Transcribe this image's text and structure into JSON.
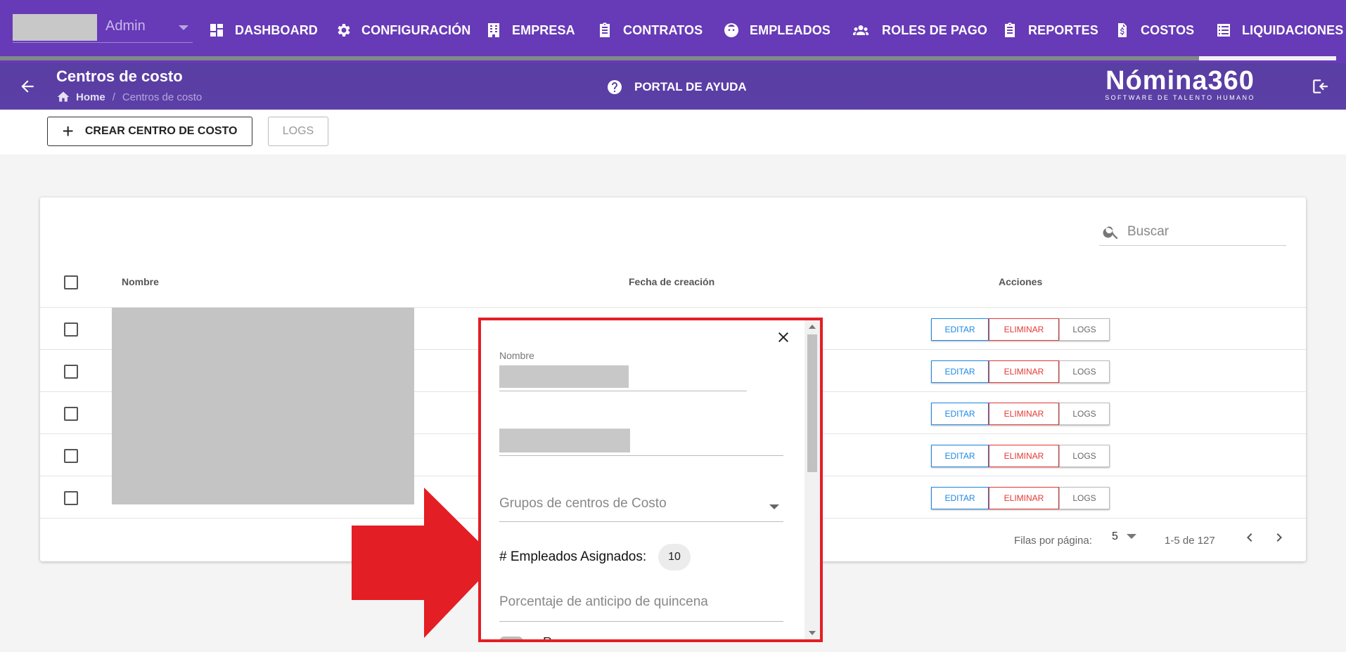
{
  "header": {
    "user_role": "Admin",
    "nav": [
      {
        "label": "DASHBOARD",
        "icon": "dashboard-icon"
      },
      {
        "label": "CONFIGURACIÓN",
        "icon": "gear-icon"
      },
      {
        "label": "EMPRESA",
        "icon": "building-icon"
      },
      {
        "label": "CONTRATOS",
        "icon": "clipboard-icon"
      },
      {
        "label": "EMPLEADOS",
        "icon": "face-icon"
      },
      {
        "label": "ROLES DE PAGO",
        "icon": "people-icon"
      },
      {
        "label": "REPORTES",
        "icon": "clipboard-icon"
      },
      {
        "label": "COSTOS",
        "icon": "dollar-file-icon"
      },
      {
        "label": "LIQUIDACIONES",
        "icon": "list-icon"
      }
    ]
  },
  "subheader": {
    "title": "Centros de costo",
    "breadcrumb_home": "Home",
    "breadcrumb_sep": "/",
    "breadcrumb_current": "Centros de costo",
    "help_label": "PORTAL DE AYUDA",
    "logo_main": "Nómina360",
    "logo_sub": "SOFTWARE DE TALENTO HUMANO"
  },
  "toolbar": {
    "create_label": "CREAR CENTRO DE COSTO",
    "create_icon": "+",
    "logs_label": "LOGS"
  },
  "table": {
    "search_placeholder": "Buscar",
    "columns": [
      "Nombre",
      "Fecha de creación",
      "Acciones"
    ],
    "row_actions": {
      "edit": "EDITAR",
      "delete": "ELIMINAR",
      "logs": "LOGS"
    },
    "row_count": 5,
    "rows_per_page_label": "Filas por página:",
    "rows_per_page_value": "5",
    "range_label": "1-5 de 127"
  },
  "dialog": {
    "field_nombre_label": "Nombre",
    "field_grupos_label": "Grupos de centros de Costo",
    "empleados_label": "# Empleados Asignados:",
    "empleados_value": "10",
    "porcentaje_label": "Porcentaje de anticipo de quincena",
    "cut_off_text": "Roca"
  },
  "colors": {
    "primary": "#673ab7",
    "subbar": "#5a3ea5",
    "edit": "#1e88e5",
    "delete": "#e53935",
    "highlight": "#e31e24"
  }
}
